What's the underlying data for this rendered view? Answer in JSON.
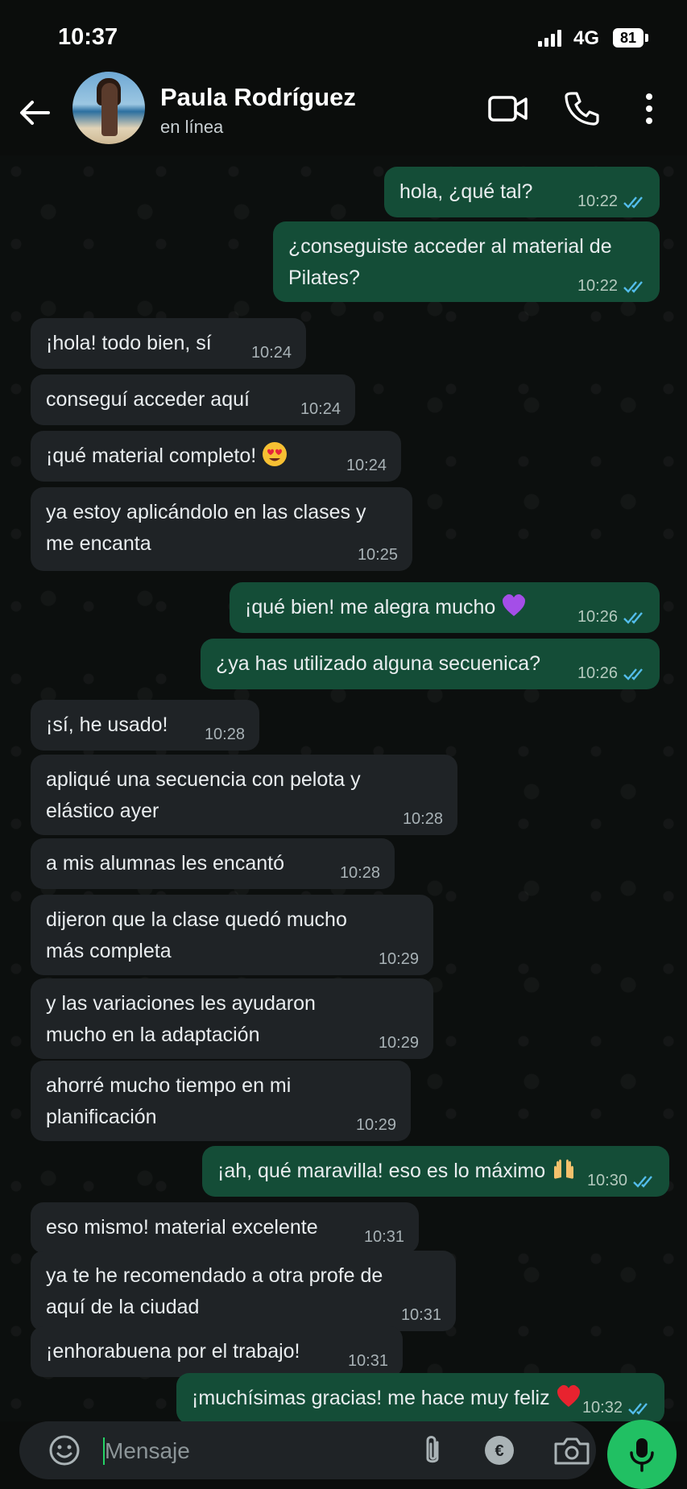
{
  "status_bar": {
    "time": "10:37",
    "network": "4G",
    "battery": "81"
  },
  "header": {
    "name": "Paula Rodríguez",
    "status": "en línea"
  },
  "messages": [
    {
      "dir": "out",
      "text": "hola, ¿qué tal?",
      "time": "10:22"
    },
    {
      "dir": "out",
      "text": "¿conseguiste acceder al material de Pilates?",
      "time": "10:22"
    },
    {
      "dir": "in",
      "text": "¡hola! todo bien, sí",
      "time": "10:24"
    },
    {
      "dir": "in",
      "text": "conseguí acceder aquí",
      "time": "10:24"
    },
    {
      "dir": "in",
      "text": "¡qué material completo!",
      "time": "10:24",
      "emoji": "heart-eyes-emoji"
    },
    {
      "dir": "in",
      "text": "ya estoy aplicándolo en las clases y me encanta",
      "time": "10:25"
    },
    {
      "dir": "out",
      "text": "¡qué bien! me alegra mucho",
      "time": "10:26",
      "emoji": "purple-heart-emoji"
    },
    {
      "dir": "out",
      "text": "¿ya has utilizado alguna secuenica?",
      "time": "10:26"
    },
    {
      "dir": "in",
      "text": "¡sí, he usado!",
      "time": "10:28"
    },
    {
      "dir": "in",
      "text": "apliqué una secuencia con pelota y elástico ayer",
      "time": "10:28"
    },
    {
      "dir": "in",
      "text": "a mis alumnas les encantó",
      "time": "10:28"
    },
    {
      "dir": "in",
      "text": "dijeron que la clase quedó mucho más completa",
      "time": "10:29"
    },
    {
      "dir": "in",
      "text": "y las variaciones les ayudaron mucho en la adaptación",
      "time": "10:29"
    },
    {
      "dir": "in",
      "text": "ahorré mucho tiempo en mi planificación",
      "time": "10:29"
    },
    {
      "dir": "out",
      "text": "¡ah, qué maravilla! eso es lo máximo",
      "time": "10:30",
      "emoji": "raising-hands-emoji"
    },
    {
      "dir": "in",
      "text": "eso mismo! material excelente",
      "time": "10:31"
    },
    {
      "dir": "in",
      "text": "ya te he recomendado a otra profe de aquí de la ciudad",
      "time": "10:31"
    },
    {
      "dir": "in",
      "text": "¡enhorabuena por el trabajo!",
      "time": "10:31"
    },
    {
      "dir": "out",
      "text": "¡muchísimas gracias! me hace muy feliz",
      "time": "10:32",
      "emoji": "red-heart-emoji"
    }
  ],
  "input": {
    "placeholder": "Mensaje"
  },
  "colors": {
    "incoming": "#1f2326",
    "outgoing": "#144d37",
    "accent": "#21c063",
    "read_ticks": "#53bdeb"
  }
}
